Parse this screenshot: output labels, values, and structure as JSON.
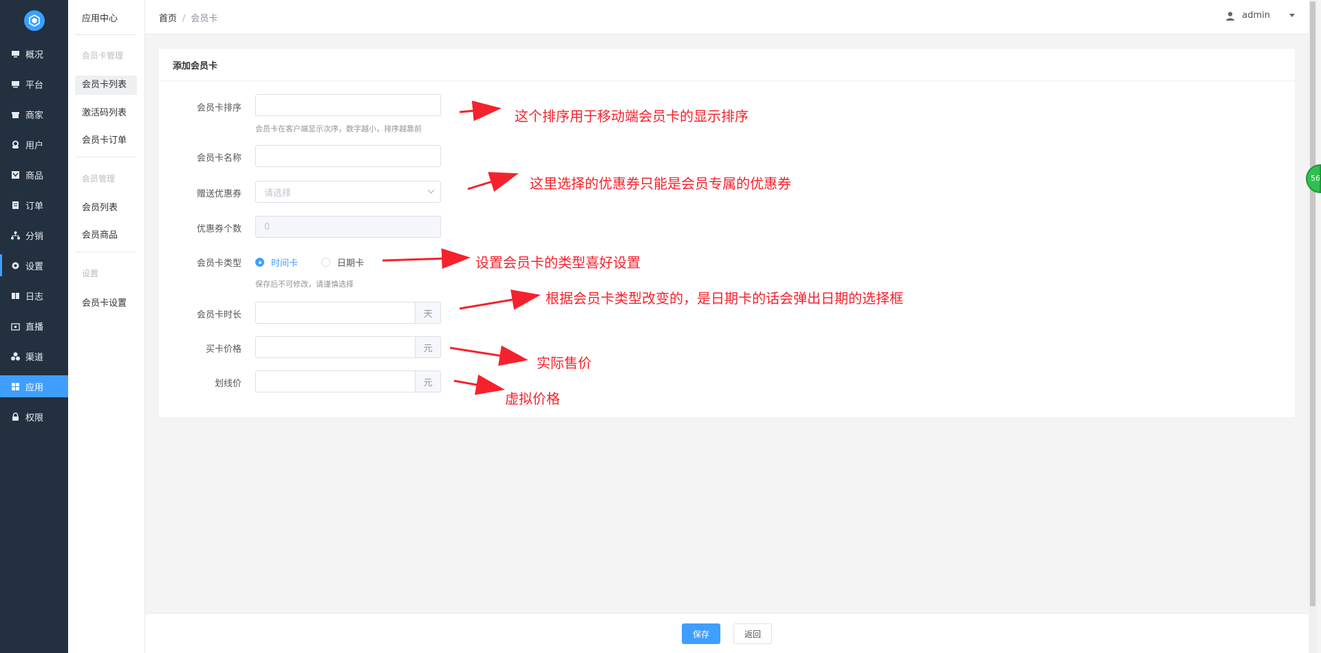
{
  "sidebar": {
    "items": [
      {
        "label": "概况",
        "icon": "monitor-icon"
      },
      {
        "label": "平台",
        "icon": "desktop-icon"
      },
      {
        "label": "商家",
        "icon": "store-icon"
      },
      {
        "label": "用户",
        "icon": "user-icon"
      },
      {
        "label": "商品",
        "icon": "goods-icon"
      },
      {
        "label": "订单",
        "icon": "clipboard-icon"
      },
      {
        "label": "分销",
        "icon": "network-icon"
      },
      {
        "label": "设置",
        "icon": "gear-icon"
      },
      {
        "label": "日志",
        "icon": "book-icon"
      },
      {
        "label": "直播",
        "icon": "live-icon"
      },
      {
        "label": "渠道",
        "icon": "channel-icon"
      },
      {
        "label": "应用",
        "icon": "grid-icon"
      },
      {
        "label": "权限",
        "icon": "lock-icon"
      }
    ],
    "active": "应用"
  },
  "subnav": {
    "title": "应用中心",
    "group1": "会员卡管理",
    "g1_items": [
      "会员卡列表",
      "激活码列表",
      "会员卡订单"
    ],
    "group2": "会员管理",
    "g2_items": [
      "会员列表",
      "会员商品"
    ],
    "group3": "设置",
    "g3_items": [
      "会员卡设置"
    ]
  },
  "topbar": {
    "home": "首页",
    "sep": "/",
    "current": "会员卡",
    "user": "admin"
  },
  "badge": "56",
  "form": {
    "title": "添加会员卡",
    "sort_label": "会员卡排序",
    "sort_value": "",
    "sort_hint": "会员卡在客户端显示次序，数字越小，排序越靠前",
    "name_label": "会员卡名称",
    "name_value": "",
    "coupon_label": "赠送优惠券",
    "coupon_placeholder": "请选择",
    "coupon_count_label": "优惠券个数",
    "coupon_count_value": "0",
    "type_label": "会员卡类型",
    "type_options": [
      "时间卡",
      "日期卡"
    ],
    "type_selected": "时间卡",
    "type_hint": "保存后不可修改，请谨慎选择",
    "duration_label": "会员卡时长",
    "duration_unit": "天",
    "price_label": "买卡价格",
    "price_unit": "元",
    "strike_label": "划线价",
    "strike_unit": "元"
  },
  "annotations": [
    "这个排序用于移动端会员卡的显示排序",
    "这里选择的优惠券只能是会员专属的优惠券",
    "设置会员卡的类型喜好设置",
    "根据会员卡类型改变的，是日期卡的话会弹出日期的选择框",
    "实际售价",
    "虚拟价格"
  ],
  "footer": {
    "save": "保存",
    "back": "返回"
  },
  "colors": {
    "sidebar_bg": "#223040",
    "accent": "#409eff",
    "annotation": "#f5222d"
  }
}
